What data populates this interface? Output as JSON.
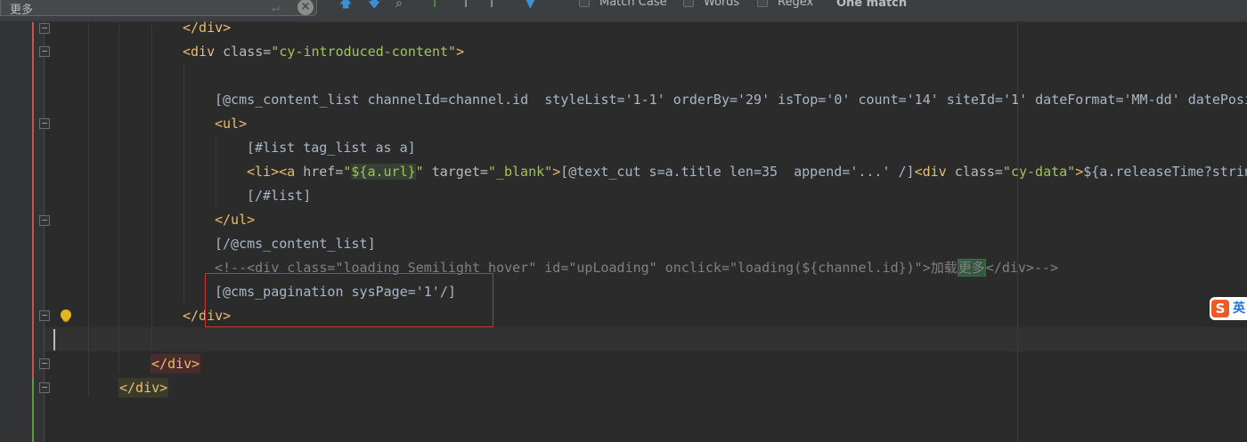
{
  "search": {
    "value": "更多",
    "options": [
      {
        "label": "Match Case",
        "checked": false
      },
      {
        "label": "Words",
        "checked": false
      },
      {
        "label": "Regex",
        "checked": false
      }
    ],
    "match_count": "One match"
  },
  "toolbar_icons": [
    "enter-icon",
    "clear-icon",
    "previous-occurrence-icon",
    "next-occurrence-icon",
    "find-all-icon",
    "add-selection-icon",
    "remove-selection-icon",
    "select-all-occurrences-icon",
    "filter-icon"
  ],
  "code": {
    "l1": {
      "close": "</div>"
    },
    "l2": {
      "open": "<div",
      "attr": " class=",
      "val": "\"cy-introduced-content\"",
      "end": ">"
    },
    "l4": {
      "text": "[@cms_content_list channelId=channel.id  styleList='1-1' orderBy='29' isTop='0' count='14' siteId='1' dateFormat='MM-dd' datePosi"
    },
    "l5": {
      "tag": "<ul>"
    },
    "l6": {
      "text": "[#list tag_list as a]"
    },
    "l7": {
      "li": "<li>",
      "a_open": "<a",
      "href_attr": " href=",
      "q1": "\"",
      "href_val": "${a.url}",
      "q2": "\"",
      "target_attr": " target=",
      "target_val": "\"_blank\"",
      "a_end": ">",
      "cut": "[@text_cut s=a.title len=35  append='...' /]",
      "div_open": "<div",
      "class_attr": " class=",
      "class_val": "\"cy-data\"",
      "div_end": ">",
      "tail": "${a.releaseTime?strin"
    },
    "l8": {
      "text": "[/#list]"
    },
    "l9": {
      "tag": "</ul>"
    },
    "l10": {
      "text": "[/@cms_content_list]"
    },
    "l11": {
      "pre": "<!--<div class=\"loading Semilight hover\" id=\"upLoading\" onclick=\"loading(${channel.id})\">加载",
      "match": "更多",
      "post": "</div>-->"
    },
    "l12": {
      "text": "[@cms_pagination sysPage='1'/]"
    },
    "l13": {
      "tag": "</div>"
    },
    "l15": {
      "tag": "</div>"
    },
    "l16": {
      "tag": "</div>"
    }
  },
  "ime_badge": {
    "logo": "S",
    "label": "英"
  }
}
